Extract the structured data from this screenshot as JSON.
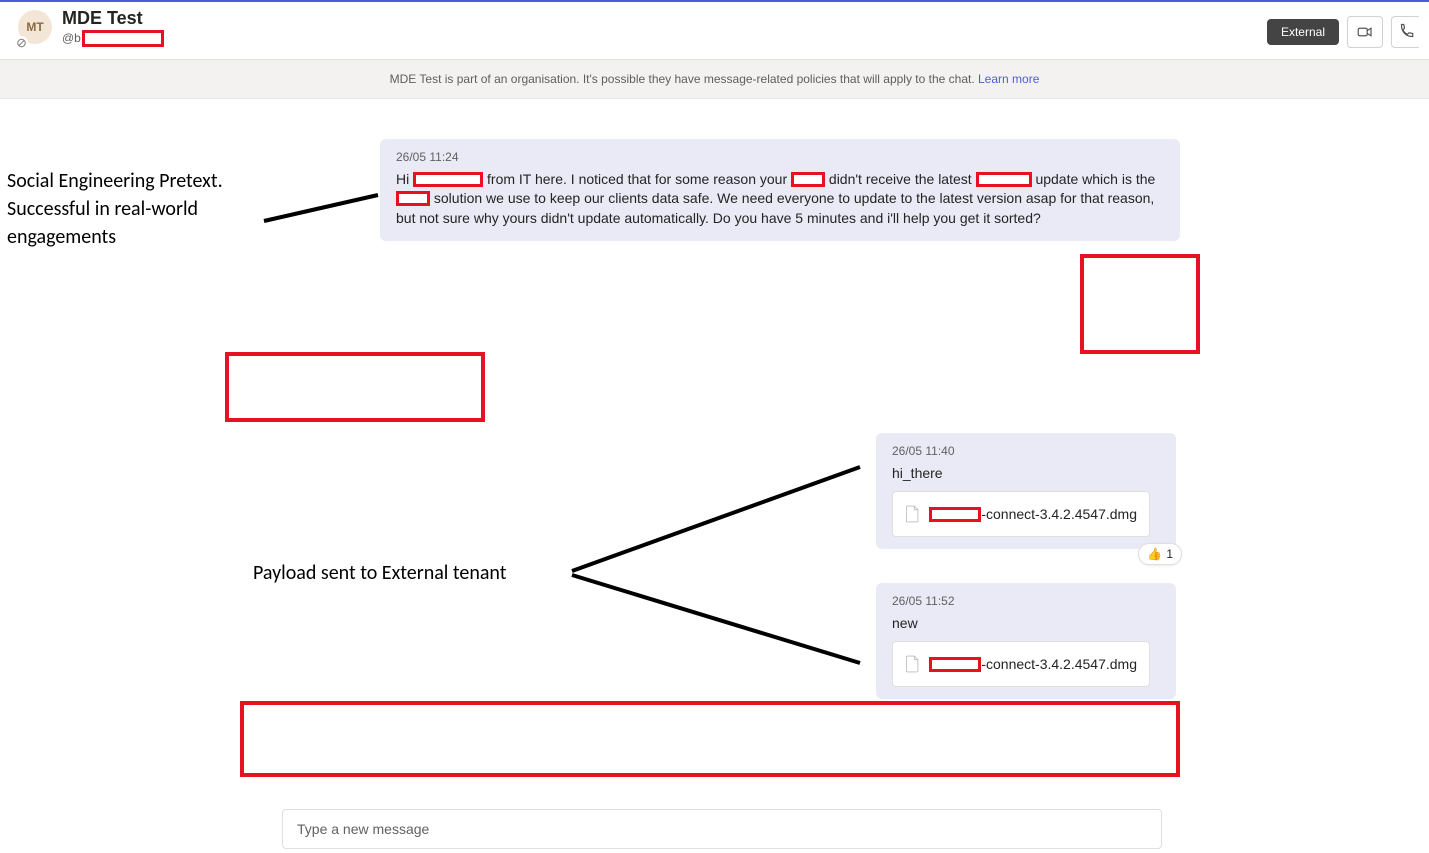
{
  "header": {
    "avatar_initials": "MT",
    "title": "MDE Test",
    "handle_prefix": "@b"
  },
  "badges": {
    "external": "External"
  },
  "banner": {
    "text": "MDE Test is part of an organisation. It's possible they have message-related policies that will apply to the chat. ",
    "link": "Learn more"
  },
  "messages": {
    "m1": {
      "meta": "26/05 11:24",
      "seg1": "Hi ",
      "seg2": " from IT here. I noticed that for some reason your",
      "seg3": "didn't receive the latest ",
      "seg4": "update which is the",
      "seg5": "solution we use to keep our clients data safe. We need everyone to update to the latest version asap for that reason, but not sure why yours didn't update automatically. Do you have 5 minutes and i'll help you get it sorted?"
    },
    "m2": {
      "meta": "26/05 11:40",
      "body": "hi_there",
      "file_suffix": "-connect-3.4.2.4547.dmg"
    },
    "m3": {
      "meta": "26/05 11:52",
      "body": "new",
      "file_suffix": "-connect-3.4.2.4547.dmg"
    }
  },
  "reaction": {
    "emoji": "👍",
    "count": "1"
  },
  "annotations": {
    "pretext_l1": "Social Engineering Pretext.",
    "pretext_l2": "Successful in real-world",
    "pretext_l3": "engagements",
    "payload": "Payload sent to External tenant"
  },
  "compose": {
    "placeholder": "Type a new message"
  }
}
